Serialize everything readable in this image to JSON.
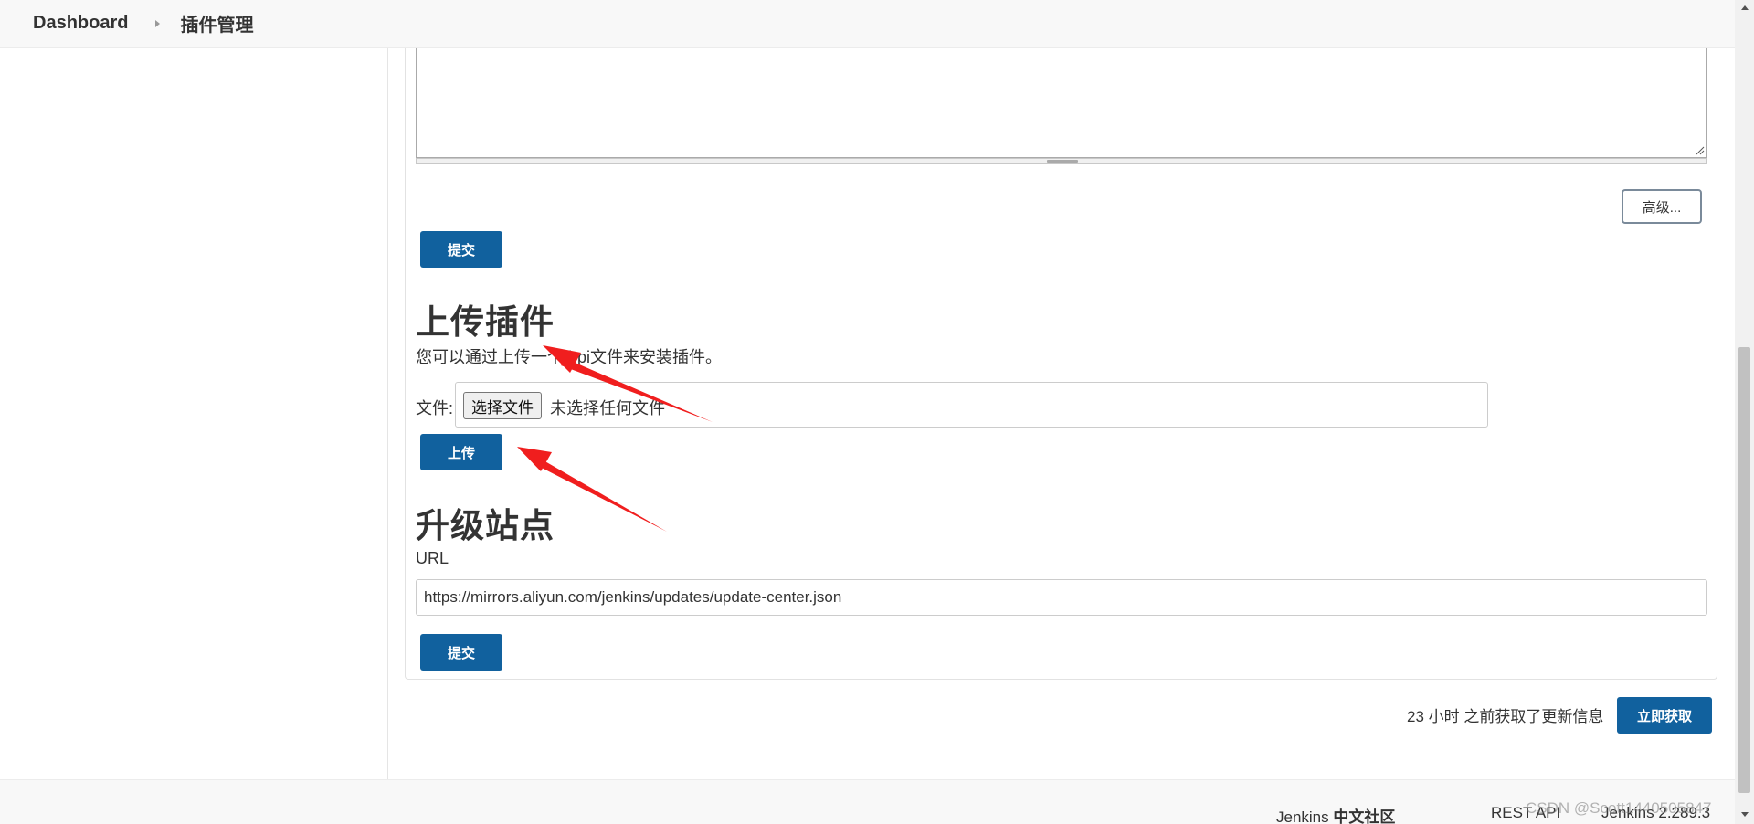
{
  "breadcrumb": {
    "items": [
      "Dashboard",
      "插件管理"
    ]
  },
  "advanced_button": "高级...",
  "submit_label": "提交",
  "upload_plugin": {
    "heading": "上传插件",
    "description": "您可以通过上传一个.hpi文件来安装插件。",
    "file_label": "文件:",
    "choose_file_button": "选择文件",
    "no_file_text": "未选择任何文件",
    "upload_button": "上传"
  },
  "update_site": {
    "heading": "升级站点",
    "url_label": "URL",
    "url_value": "https://mirrors.aliyun.com/jenkins/updates/update-center.json",
    "submit_button": "提交"
  },
  "update_status": {
    "text": "23 小时 之前获取了更新信息",
    "fetch_now_button": "立即获取"
  },
  "footer": {
    "community_prefix": "Jenkins",
    "community_suffix": "中文社区",
    "rest_api": "REST API",
    "version": "Jenkins 2.289.3"
  },
  "watermark": "CSDN @Scott1440505847",
  "colors": {
    "primary_button": "#11619e",
    "annotation_arrow": "#f01e1e"
  }
}
